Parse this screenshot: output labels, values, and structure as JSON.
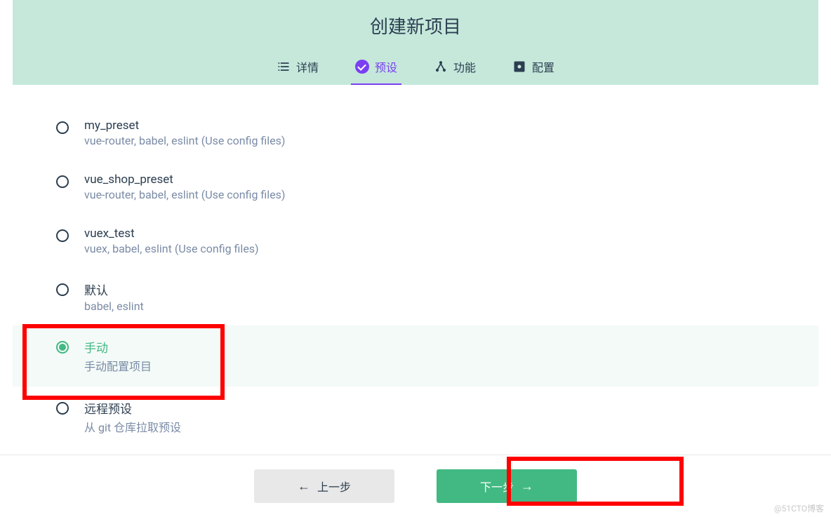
{
  "header": {
    "title": "创建新项目"
  },
  "tabs": [
    {
      "label": "详情",
      "icon": "list-icon",
      "active": false
    },
    {
      "label": "预设",
      "icon": "check-icon",
      "active": true
    },
    {
      "label": "功能",
      "icon": "share-icon",
      "active": false
    },
    {
      "label": "配置",
      "icon": "config-icon",
      "active": false
    }
  ],
  "presets": [
    {
      "title": "my_preset",
      "desc": "vue-router, babel, eslint (Use config files)",
      "selected": false
    },
    {
      "title": "vue_shop_preset",
      "desc": "vue-router, babel, eslint (Use config files)",
      "selected": false
    },
    {
      "title": "vuex_test",
      "desc": "vuex, babel, eslint (Use config files)",
      "selected": false
    },
    {
      "title": "默认",
      "desc": "babel, eslint",
      "selected": false
    },
    {
      "title": "手动",
      "desc": "手动配置项目",
      "selected": true
    },
    {
      "title": "远程预设",
      "desc": "从 git 仓库拉取预设",
      "selected": false
    }
  ],
  "buttons": {
    "prev": "上一步",
    "next": "下一步"
  },
  "watermark": "@51CTO博客"
}
